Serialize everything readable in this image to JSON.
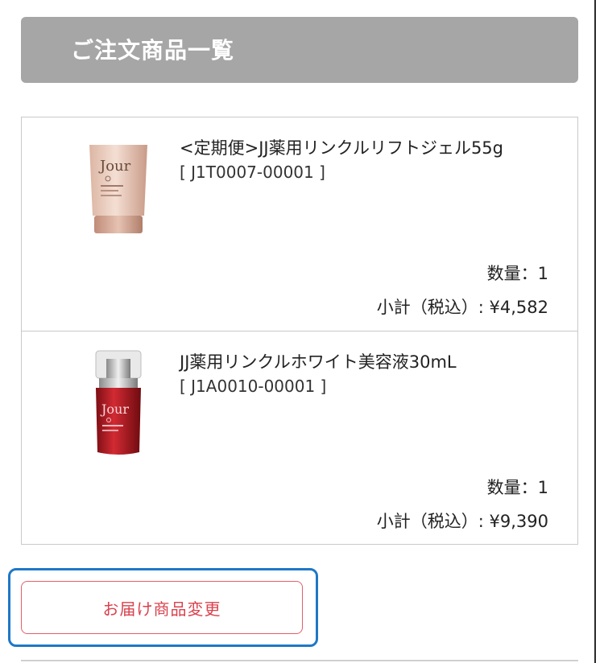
{
  "section": {
    "title": "ご注文商品一覧"
  },
  "items": [
    {
      "name": "<定期便>JJ薬用リンクルリフトジェル55g",
      "code": "[ J1T0007-00001 ]",
      "quantity": "数量：1",
      "subtotal": "小計（税込）: ¥4,582",
      "image_brand": "Jour",
      "image_icon": "tube-product-image"
    },
    {
      "name": "JJ薬用リンクルホワイト美容液30mL",
      "code": "[ J1A0010-00001 ]",
      "quantity": "数量：1",
      "subtotal": "小計（税込）: ¥9,390",
      "image_brand": "Jour",
      "image_icon": "bottle-product-image"
    }
  ],
  "actions": {
    "change_label": "お届け商品変更"
  },
  "colors": {
    "header_bg": "#a6a6a6",
    "accent_red": "#d9424e",
    "focus_blue": "#1f78c8"
  }
}
